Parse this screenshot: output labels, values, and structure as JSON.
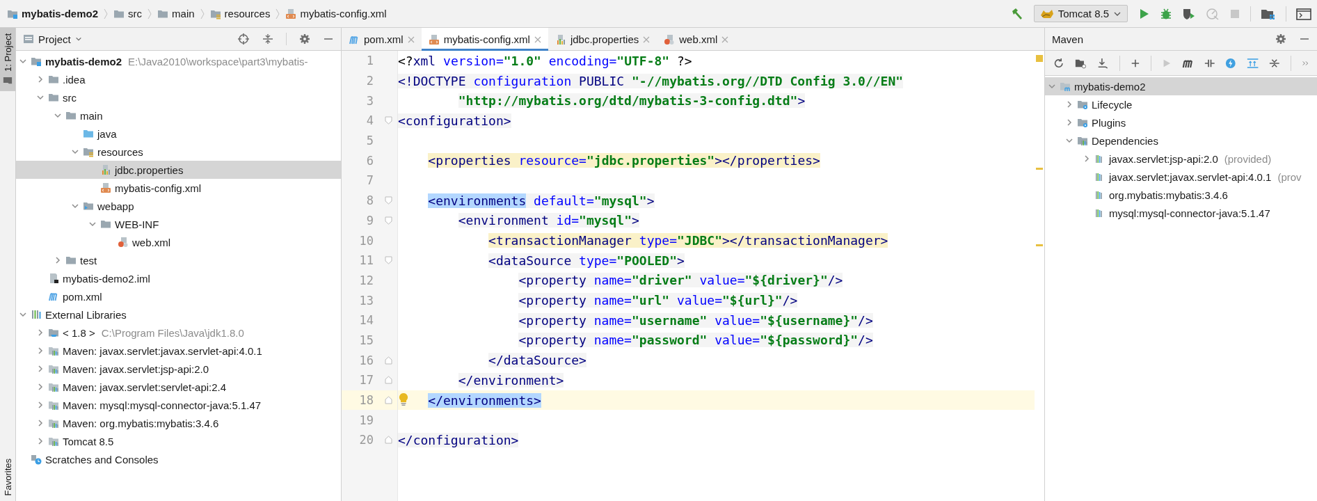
{
  "breadcrumbs": [
    {
      "label": "mybatis-demo2",
      "kind": "module"
    },
    {
      "label": "src",
      "kind": "folder"
    },
    {
      "label": "main",
      "kind": "folder"
    },
    {
      "label": "resources",
      "kind": "resource-folder"
    },
    {
      "label": "mybatis-config.xml",
      "kind": "xml"
    }
  ],
  "run_configuration": {
    "label": "Tomcat 8.5"
  },
  "tool_stripe": [
    {
      "label": "1: Project",
      "selected": true
    },
    {
      "label": "Favorites",
      "selected": false
    }
  ],
  "project": {
    "title": "Project",
    "tree": [
      {
        "label": "mybatis-demo2",
        "kind": "module",
        "path": "E:\\Java2010\\workspace\\part3\\mybatis-",
        "expanded": true,
        "selected": false,
        "children": [
          {
            "label": ".idea",
            "kind": "folder",
            "expanded": false,
            "selected": false
          },
          {
            "label": "src",
            "kind": "folder",
            "expanded": true,
            "selected": false,
            "children": [
              {
                "label": "main",
                "kind": "folder",
                "expanded": true,
                "selected": false,
                "children": [
                  {
                    "label": "java",
                    "kind": "source-folder",
                    "selected": false
                  },
                  {
                    "label": "resources",
                    "kind": "resource-folder",
                    "expanded": true,
                    "selected": false,
                    "children": [
                      {
                        "label": "jdbc.properties",
                        "kind": "properties",
                        "selected": true
                      },
                      {
                        "label": "mybatis-config.xml",
                        "kind": "xml",
                        "selected": false
                      }
                    ]
                  },
                  {
                    "label": "webapp",
                    "kind": "web-folder",
                    "expanded": true,
                    "selected": false,
                    "children": [
                      {
                        "label": "WEB-INF",
                        "kind": "folder",
                        "expanded": true,
                        "selected": false,
                        "children": [
                          {
                            "label": "web.xml",
                            "kind": "web-xml",
                            "selected": false
                          }
                        ]
                      }
                    ]
                  }
                ]
              },
              {
                "label": "test",
                "kind": "folder",
                "expanded": false,
                "selected": false
              }
            ]
          },
          {
            "label": "mybatis-demo2.iml",
            "kind": "iml",
            "selected": false
          },
          {
            "label": "pom.xml",
            "kind": "maven",
            "selected": false
          }
        ]
      },
      {
        "label": "External Libraries",
        "kind": "libraries",
        "expanded": true,
        "selected": false,
        "children": [
          {
            "label": "< 1.8 >",
            "kind": "sdk",
            "path": "C:\\Program Files\\Java\\jdk1.8.0",
            "expanded": false,
            "selected": false
          },
          {
            "label": "Maven: javax.servlet:javax.servlet-api:4.0.1",
            "kind": "library",
            "expanded": false,
            "selected": false
          },
          {
            "label": "Maven: javax.servlet:jsp-api:2.0",
            "kind": "library",
            "expanded": false,
            "selected": false
          },
          {
            "label": "Maven: javax.servlet:servlet-api:2.4",
            "kind": "library",
            "expanded": false,
            "selected": false
          },
          {
            "label": "Maven: mysql:mysql-connector-java:5.1.47",
            "kind": "library",
            "expanded": false,
            "selected": false
          },
          {
            "label": "Maven: org.mybatis:mybatis:3.4.6",
            "kind": "library",
            "expanded": false,
            "selected": false
          },
          {
            "label": "Tomcat 8.5",
            "kind": "library",
            "expanded": false,
            "selected": false
          }
        ]
      },
      {
        "label": "Scratches and Consoles",
        "kind": "scratches",
        "selected": false
      }
    ]
  },
  "editor": {
    "tabs": [
      {
        "label": "pom.xml",
        "kind": "maven",
        "selected": false
      },
      {
        "label": "mybatis-config.xml",
        "kind": "xml",
        "selected": true
      },
      {
        "label": "jdbc.properties",
        "kind": "properties",
        "selected": false
      },
      {
        "label": "web.xml",
        "kind": "web-xml",
        "selected": false
      }
    ],
    "lines": [
      {
        "number": "1",
        "kind": "plain",
        "caret": false,
        "tokens": [
          {
            "text": "<?",
            "kind": "plain"
          },
          {
            "text": "xml",
            "kind": "tag"
          },
          {
            "text": " version=",
            "kind": "attr"
          },
          {
            "text": "\"1.0\"",
            "kind": "str"
          },
          {
            "text": " encoding=",
            "kind": "attr"
          },
          {
            "text": "\"UTF-8\"",
            "kind": "str"
          },
          {
            "text": " ?>",
            "kind": "plain"
          }
        ]
      },
      {
        "number": "2",
        "kind": "injected",
        "caret": false,
        "tokens": [
          {
            "text": "<!DOCTYPE",
            "kind": "tag"
          },
          {
            "text": " configuration",
            "kind": "attr"
          },
          {
            "text": " PUBLIC",
            "kind": "tag"
          },
          {
            "text": " \"-//mybatis.org//DTD Config 3.0//EN\"",
            "kind": "str"
          }
        ]
      },
      {
        "number": "3",
        "kind": "injected",
        "caret": false,
        "tokens": [
          {
            "text": "        \"http://mybatis.org/dtd/mybatis-3-config.dtd\"",
            "kind": "str"
          },
          {
            "text": ">",
            "kind": "tag"
          }
        ]
      },
      {
        "number": "4",
        "kind": "injected",
        "caret": false,
        "fold_start": true,
        "tokens": [
          {
            "text": "<configuration>",
            "kind": "tag"
          }
        ]
      },
      {
        "number": "5",
        "kind": "plain",
        "caret": false
      },
      {
        "number": "6",
        "kind": "warning",
        "caret": false,
        "tokens": [
          {
            "text": "    <properties",
            "kind": "tag"
          },
          {
            "text": " resource=",
            "kind": "attr"
          },
          {
            "text": "\"jdbc.properties\"",
            "kind": "str"
          },
          {
            "text": "></properties>",
            "kind": "tag"
          }
        ]
      },
      {
        "number": "7",
        "kind": "plain",
        "caret": false
      },
      {
        "number": "8",
        "kind": "injected",
        "caret": false,
        "fold_start": true,
        "tokens": [
          {
            "text": "    <environments",
            "kind": "tag",
            "match": true
          },
          {
            "text": " default=",
            "kind": "attr"
          },
          {
            "text": "\"mysql\"",
            "kind": "str"
          },
          {
            "text": ">",
            "kind": "tag"
          }
        ]
      },
      {
        "number": "9",
        "kind": "injected",
        "caret": false,
        "fold_start": true,
        "tokens": [
          {
            "text": "        <environment",
            "kind": "tag"
          },
          {
            "text": " id=",
            "kind": "attr"
          },
          {
            "text": "\"mysql\"",
            "kind": "str"
          },
          {
            "text": ">",
            "kind": "tag"
          }
        ]
      },
      {
        "number": "10",
        "kind": "warning",
        "caret": false,
        "tokens": [
          {
            "text": "            <transactionManager",
            "kind": "tag"
          },
          {
            "text": " type=",
            "kind": "attr"
          },
          {
            "text": "\"JDBC\"",
            "kind": "str"
          },
          {
            "text": "></transactionManager>",
            "kind": "tag"
          }
        ]
      },
      {
        "number": "11",
        "kind": "injected",
        "caret": false,
        "fold_start": true,
        "tokens": [
          {
            "text": "            <dataSource",
            "kind": "tag"
          },
          {
            "text": " type=",
            "kind": "attr"
          },
          {
            "text": "\"POOLED\"",
            "kind": "str"
          },
          {
            "text": ">",
            "kind": "tag"
          }
        ]
      },
      {
        "number": "12",
        "kind": "injected",
        "caret": false,
        "tokens": [
          {
            "text": "                <property",
            "kind": "tag"
          },
          {
            "text": " name=",
            "kind": "attr"
          },
          {
            "text": "\"driver\"",
            "kind": "str"
          },
          {
            "text": " value=",
            "kind": "attr"
          },
          {
            "text": "\"${driver}\"",
            "kind": "str"
          },
          {
            "text": "/>",
            "kind": "tag"
          }
        ]
      },
      {
        "number": "13",
        "kind": "injected",
        "caret": false,
        "tokens": [
          {
            "text": "                <property",
            "kind": "tag"
          },
          {
            "text": " name=",
            "kind": "attr"
          },
          {
            "text": "\"url\"",
            "kind": "str"
          },
          {
            "text": " value=",
            "kind": "attr"
          },
          {
            "text": "\"${url}\"",
            "kind": "str"
          },
          {
            "text": "/>",
            "kind": "tag"
          }
        ]
      },
      {
        "number": "14",
        "kind": "injected",
        "caret": false,
        "tokens": [
          {
            "text": "                <property",
            "kind": "tag"
          },
          {
            "text": " name=",
            "kind": "attr"
          },
          {
            "text": "\"username\"",
            "kind": "str"
          },
          {
            "text": " value=",
            "kind": "attr"
          },
          {
            "text": "\"${username}\"",
            "kind": "str"
          },
          {
            "text": "/>",
            "kind": "tag"
          }
        ]
      },
      {
        "number": "15",
        "kind": "injected",
        "caret": false,
        "tokens": [
          {
            "text": "                <property",
            "kind": "tag"
          },
          {
            "text": " name=",
            "kind": "attr"
          },
          {
            "text": "\"password\"",
            "kind": "str"
          },
          {
            "text": " value=",
            "kind": "attr"
          },
          {
            "text": "\"${password}\"",
            "kind": "str"
          },
          {
            "text": "/>",
            "kind": "tag"
          }
        ]
      },
      {
        "number": "16",
        "kind": "injected",
        "caret": false,
        "fold_end": true,
        "tokens": [
          {
            "text": "            </dataSource>",
            "kind": "tag"
          }
        ]
      },
      {
        "number": "17",
        "kind": "injected",
        "caret": false,
        "fold_end": true,
        "tokens": [
          {
            "text": "        </environment>",
            "kind": "tag"
          }
        ]
      },
      {
        "number": "18",
        "kind": "plain",
        "caret": true,
        "fold_end": true,
        "tokens": [
          {
            "text": "    </environments>",
            "kind": "tag",
            "match": true
          }
        ]
      },
      {
        "number": "19",
        "kind": "plain",
        "caret": false
      },
      {
        "number": "20",
        "kind": "injected",
        "caret": false,
        "fold_end": true,
        "tokens": [
          {
            "text": "</configuration>",
            "kind": "tag"
          }
        ]
      }
    ]
  },
  "maven": {
    "title": "Maven",
    "tree": [
      {
        "label": "mybatis-demo2",
        "kind": "maven-project",
        "expanded": true,
        "selected": true,
        "children": [
          {
            "label": "Lifecycle",
            "kind": "lifecycle",
            "expanded": false,
            "selected": false
          },
          {
            "label": "Plugins",
            "kind": "lifecycle",
            "expanded": false,
            "selected": false
          },
          {
            "label": "Dependencies",
            "kind": "dependencies",
            "expanded": true,
            "selected": false,
            "children": [
              {
                "label": "javax.servlet:jsp-api:2.0",
                "kind": "dependency",
                "path": "(provided)",
                "expanded": false,
                "selected": false
              },
              {
                "label": "javax.servlet:javax.servlet-api:4.0.1",
                "kind": "dependency",
                "path": "(prov",
                "selected": false
              },
              {
                "label": "org.mybatis:mybatis:3.4.6",
                "kind": "dependency",
                "selected": false
              },
              {
                "label": "mysql:mysql-connector-java:5.1.47",
                "kind": "dependency",
                "selected": false
              }
            ]
          }
        ]
      }
    ]
  }
}
